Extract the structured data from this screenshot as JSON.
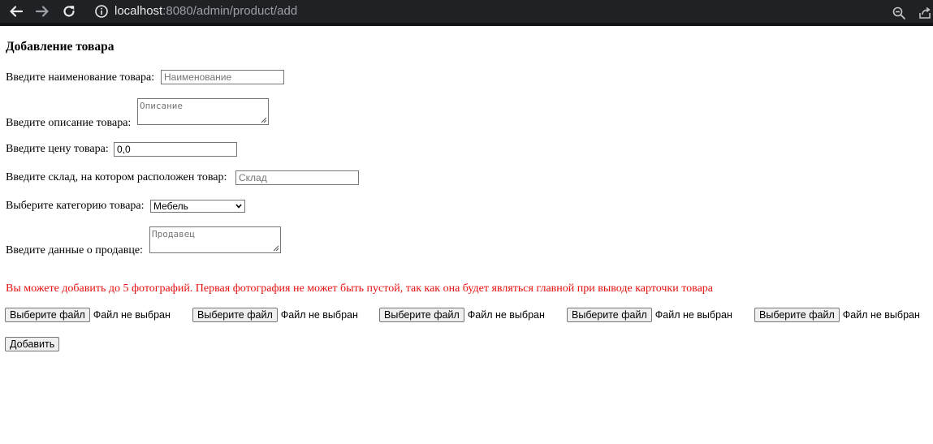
{
  "browser": {
    "url_host": "localhost",
    "url_rest": ":8080/admin/product/add"
  },
  "form": {
    "title": "Добавление товара",
    "name": {
      "label": "Введите наименование товара:",
      "placeholder": "Наименование",
      "value": ""
    },
    "description": {
      "label": "Введите описание товара:",
      "placeholder": "Описание"
    },
    "price": {
      "label": "Введите цену товара:",
      "value": "0,0"
    },
    "warehouse": {
      "label": "Введите склад, на котором расположен товар:",
      "placeholder": "Склад"
    },
    "category": {
      "label": "Выберите категорию товара:",
      "selected": "Мебель"
    },
    "seller": {
      "label": "Введите данные о продавце:",
      "placeholder": "Продавец"
    },
    "notice": "Вы можете добавить до 5 фотографий. Первая фотография не может быть пустой, так как она будет являться главной при выводе карточки товара",
    "files": [
      {
        "button": "Выберите файл",
        "status": "Файл не выбран"
      },
      {
        "button": "Выберите файл",
        "status": "Файл не выбран"
      },
      {
        "button": "Выберите файл",
        "status": "Файл не выбран"
      },
      {
        "button": "Выберите файл",
        "status": "Файл не выбран"
      },
      {
        "button": "Выберите файл",
        "status": "Файл не выбран"
      }
    ],
    "submit_label": "Добавить"
  },
  "colors": {
    "chrome_bg": "#202124",
    "notice": "#e8110f"
  },
  "icons": {
    "back": "arrow-left-icon",
    "forward": "arrow-right-icon",
    "reload": "reload-icon",
    "site_info": "info-circle-icon",
    "zoom": "zoom-out-icon",
    "share": "share-icon"
  }
}
